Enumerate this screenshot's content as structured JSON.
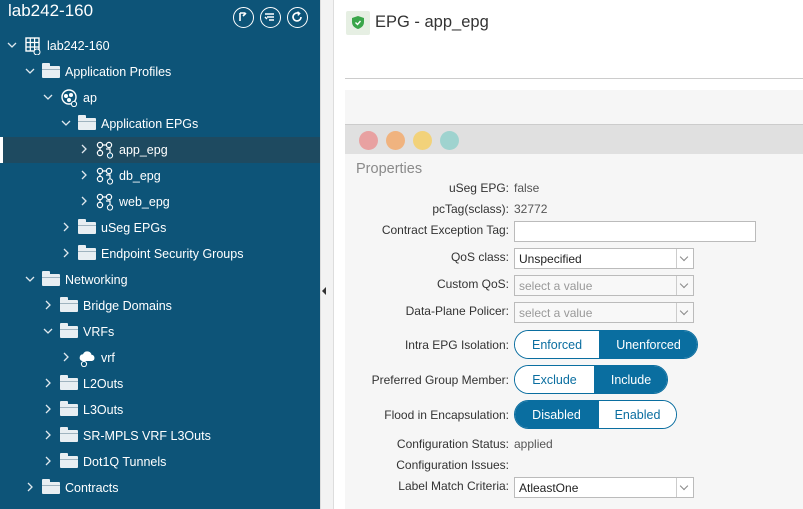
{
  "sidebar": {
    "title": "lab242-160",
    "tree": [
      {
        "label": "lab242-160",
        "icon": "tenant-icon",
        "level": 0,
        "chevron": "down"
      },
      {
        "label": "Application Profiles",
        "icon": "folder-icon",
        "level": 1,
        "chevron": "down"
      },
      {
        "label": "ap",
        "icon": "app-profile-icon",
        "level": 2,
        "chevron": "down"
      },
      {
        "label": "Application EPGs",
        "icon": "folder-icon",
        "level": 3,
        "chevron": "down"
      },
      {
        "label": "app_epg",
        "icon": "epg-icon",
        "level": 4,
        "chevron": "right",
        "selected": true
      },
      {
        "label": "db_epg",
        "icon": "epg-icon",
        "level": 4,
        "chevron": "right"
      },
      {
        "label": "web_epg",
        "icon": "epg-icon",
        "level": 4,
        "chevron": "right"
      },
      {
        "label": "uSeg EPGs",
        "icon": "folder-icon",
        "level": 3,
        "chevron": "right"
      },
      {
        "label": "Endpoint Security Groups",
        "icon": "folder-icon",
        "level": 3,
        "chevron": "right"
      },
      {
        "label": "Networking",
        "icon": "folder-icon",
        "level": 1,
        "chevron": "down"
      },
      {
        "label": "Bridge Domains",
        "icon": "folder-icon",
        "level": 2,
        "chevron": "right"
      },
      {
        "label": "VRFs",
        "icon": "folder-icon",
        "level": 2,
        "chevron": "down"
      },
      {
        "label": "vrf",
        "icon": "vrf-cloud-icon",
        "level": 3,
        "chevron": "right"
      },
      {
        "label": "L2Outs",
        "icon": "folder-icon",
        "level": 2,
        "chevron": "right"
      },
      {
        "label": "L3Outs",
        "icon": "folder-icon",
        "level": 2,
        "chevron": "right"
      },
      {
        "label": "SR-MPLS VRF L3Outs",
        "icon": "folder-icon",
        "level": 2,
        "chevron": "right"
      },
      {
        "label": "Dot1Q Tunnels",
        "icon": "folder-icon",
        "level": 2,
        "chevron": "right"
      },
      {
        "label": "Contracts",
        "icon": "folder-icon",
        "level": 1,
        "chevron": "right"
      }
    ]
  },
  "main": {
    "title": "EPG - app_epg",
    "properties_title": "Properties",
    "faults": [
      {
        "name": "critical-fault-icon",
        "color": "#e8a1a1"
      },
      {
        "name": "major-fault-icon",
        "color": "#f0b37f"
      },
      {
        "name": "minor-fault-icon",
        "color": "#f2d27a"
      },
      {
        "name": "warning-fault-icon",
        "color": "#9fd3cf"
      }
    ],
    "props": {
      "useg_label": "uSeg EPG:",
      "useg_value": "false",
      "pctag_label": "pcTag(sclass):",
      "pctag_value": "32772",
      "contract_exc_label": "Contract Exception Tag:",
      "contract_exc_value": "",
      "qos_label": "QoS class:",
      "qos_value": "Unspecified",
      "custom_qos_label": "Custom QoS:",
      "custom_qos_placeholder": "select a value",
      "policer_label": "Data-Plane Policer:",
      "policer_placeholder": "select a value",
      "intra_label": "Intra EPG Isolation:",
      "intra_opts": [
        "Enforced",
        "Unenforced"
      ],
      "intra_selected": "Unenforced",
      "pref_label": "Preferred Group Member:",
      "pref_opts": [
        "Exclude",
        "Include"
      ],
      "pref_selected": "Include",
      "flood_label": "Flood in Encapsulation:",
      "flood_opts": [
        "Disabled",
        "Enabled"
      ],
      "flood_selected": "Disabled",
      "config_status_label": "Configuration Status:",
      "config_status_value": "applied",
      "config_issues_label": "Configuration Issues:",
      "config_issues_value": "",
      "label_match_label": "Label Match Criteria:",
      "label_match_value": "AtleastOne"
    }
  }
}
